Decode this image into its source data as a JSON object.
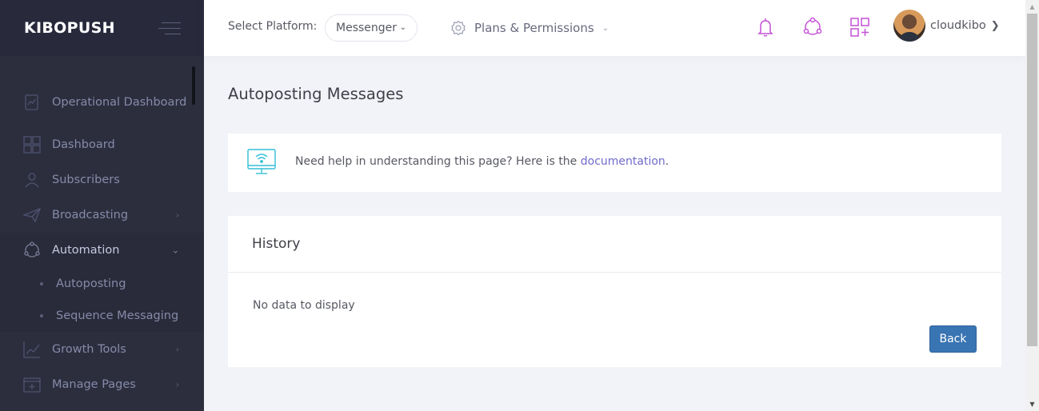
{
  "brand": {
    "name": "KIBOPUSH"
  },
  "sidebar": {
    "items": [
      {
        "label": "Operational Dashboard",
        "icon": "chart-doc-icon"
      },
      {
        "label": "Dashboard",
        "icon": "grid-icon"
      },
      {
        "label": "Subscribers",
        "icon": "user-icon"
      },
      {
        "label": "Broadcasting",
        "icon": "paper-plane-icon",
        "has_arrow": true
      },
      {
        "label": "Automation",
        "icon": "share-cycle-icon",
        "expanded": true
      },
      {
        "label": "Growth Tools",
        "icon": "line-chart-icon",
        "has_arrow": true
      },
      {
        "label": "Manage Pages",
        "icon": "add-page-icon",
        "has_arrow": true
      }
    ],
    "automation_children": [
      {
        "label": "Autoposting"
      },
      {
        "label": "Sequence Messaging"
      }
    ]
  },
  "header": {
    "select_platform_label": "Select Platform:",
    "platform_value": "Messenger",
    "plans_label": "Plans & Permissions",
    "username": "cloudkibo",
    "icons": [
      "bell-icon",
      "share-icon",
      "apps-icon"
    ]
  },
  "main": {
    "title": "Autoposting Messages",
    "help": {
      "text": "Need help in understanding this page? Here is the ",
      "link_text": "documentation",
      "suffix": "."
    },
    "history": {
      "title": "History",
      "empty_text": "No data to display",
      "back_label": "Back"
    }
  },
  "colors": {
    "sidebar_bg": "#2c2e3e",
    "brand_bg": "#282a3c",
    "accent_pink": "#c451d6",
    "link": "#716aca",
    "back_button": "#3974b3",
    "help_icon": "#34bfd6"
  }
}
